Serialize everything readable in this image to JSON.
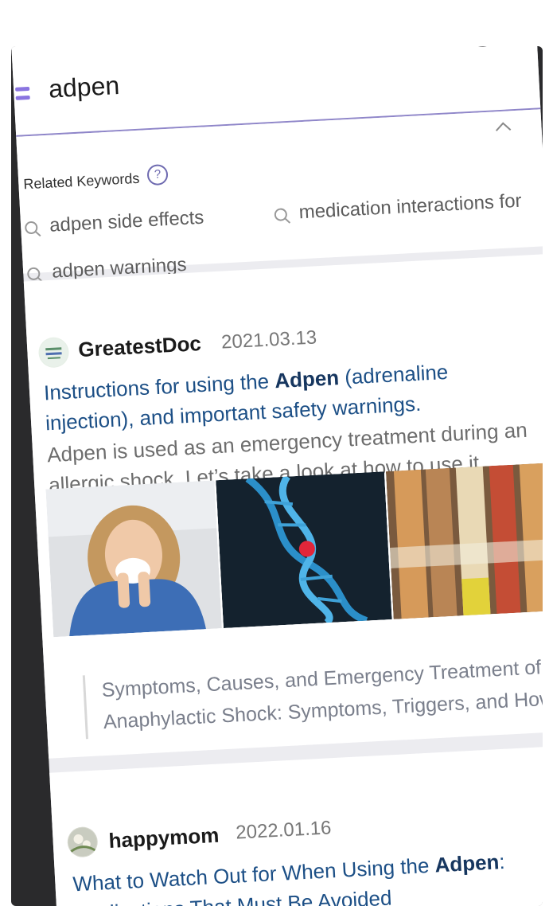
{
  "search": {
    "query": "adpen",
    "clear_symbol": "×"
  },
  "related": {
    "title": "Related Keywords",
    "help_symbol": "?",
    "keywords": [
      "adpen side effects",
      "medication interactions for",
      "adpen warnings"
    ]
  },
  "posts": [
    {
      "author": "GreatestDoc",
      "date": "2021.03.13",
      "title_pre": "Instructions for using the ",
      "title_bold": "Adpen",
      "title_post": " (adrenaline injection), and important safety warnings.",
      "snippet": "Adpen is used as an emergency treatment during an allergic shock. Let’s take a look at how to use it...",
      "images": [
        "woman-sneezing-photo",
        "dna-helix-image",
        "adrenaline-pens-photo"
      ],
      "related_links": [
        "Symptoms, Causes, and Emergency Treatment of An",
        "Anaphylactic Shock: Symptoms, Triggers, and How"
      ]
    },
    {
      "author": "happymom",
      "date": "2022.01.16",
      "title_pre": "What to Watch Out for When Using the ",
      "title_bold": "Adpen",
      "title_post": ": Medications That Must Be Avoided"
    }
  ],
  "colors": {
    "link": "#1c4f86",
    "accent": "#8a74e0",
    "page_bg": "#ececf0"
  }
}
